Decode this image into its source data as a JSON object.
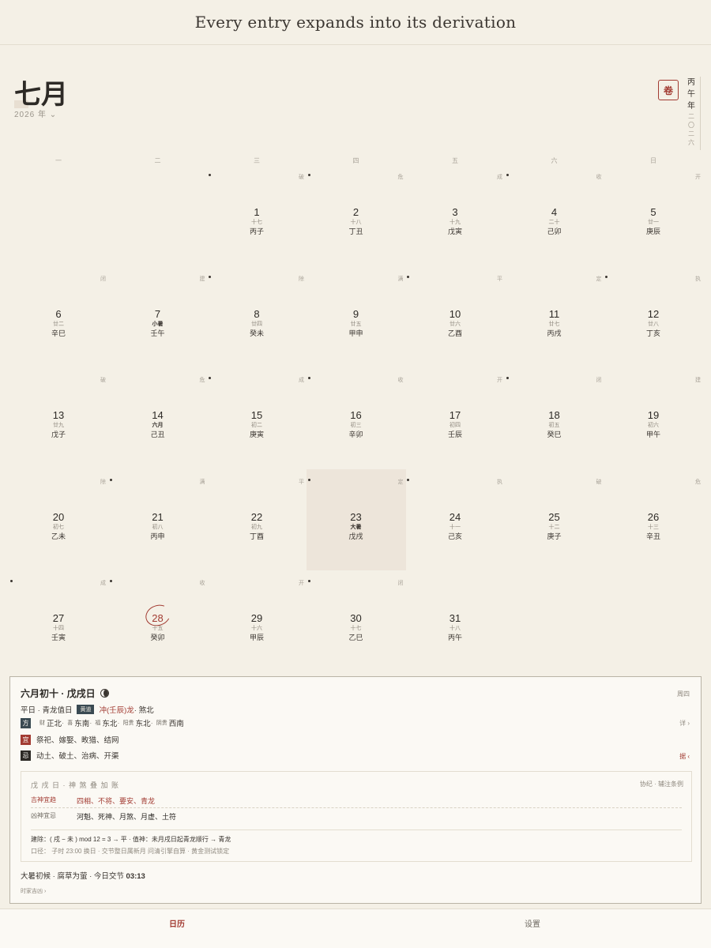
{
  "caption": "Every entry expands into its derivation",
  "header": {
    "month": "七月",
    "year_selector": "2026 年 ⌄",
    "scroll_button": "卷",
    "vertical_year": [
      "丙",
      "午",
      "年"
    ],
    "vertical_year_sub": [
      "二",
      "〇",
      "二",
      "六"
    ]
  },
  "weekdays": [
    "一",
    "二",
    "三",
    "四",
    "五",
    "六",
    "日"
  ],
  "days": [
    {
      "d": "1",
      "lunar": "十七",
      "gz": "丙子",
      "officer": "破",
      "col": 2,
      "row": 0,
      "dot": true
    },
    {
      "d": "2",
      "lunar": "十八",
      "gz": "丁丑",
      "officer": "危",
      "col": 3,
      "row": 0,
      "dot": true
    },
    {
      "d": "3",
      "lunar": "十九",
      "gz": "戊寅",
      "officer": "成",
      "col": 4,
      "row": 0,
      "dot": false
    },
    {
      "d": "4",
      "lunar": "二十",
      "gz": "己卯",
      "officer": "收",
      "col": 5,
      "row": 0,
      "dot": true
    },
    {
      "d": "5",
      "lunar": "廿一",
      "gz": "庚辰",
      "officer": "开",
      "col": 6,
      "row": 0,
      "dot": false
    },
    {
      "d": "6",
      "lunar": "廿二",
      "gz": "辛巳",
      "officer": "闭",
      "col": 0,
      "row": 1,
      "dot": false
    },
    {
      "d": "7",
      "lunar": "小暑",
      "gz": "壬午",
      "officer": "建",
      "col": 1,
      "row": 1,
      "dot": false,
      "term": true
    },
    {
      "d": "8",
      "lunar": "廿四",
      "gz": "癸未",
      "officer": "除",
      "col": 2,
      "row": 1,
      "dot": true
    },
    {
      "d": "9",
      "lunar": "廿五",
      "gz": "甲申",
      "officer": "满",
      "col": 3,
      "row": 1,
      "dot": false
    },
    {
      "d": "10",
      "lunar": "廿六",
      "gz": "乙酉",
      "officer": "平",
      "col": 4,
      "row": 1,
      "dot": true
    },
    {
      "d": "11",
      "lunar": "廿七",
      "gz": "丙戌",
      "officer": "定",
      "col": 5,
      "row": 1,
      "dot": false
    },
    {
      "d": "12",
      "lunar": "廿八",
      "gz": "丁亥",
      "officer": "执",
      "col": 6,
      "row": 1,
      "dot": true
    },
    {
      "d": "13",
      "lunar": "廿九",
      "gz": "戊子",
      "officer": "破",
      "col": 0,
      "row": 2,
      "dot": false
    },
    {
      "d": "14",
      "lunar": "六月",
      "gz": "己丑",
      "officer": "危",
      "col": 1,
      "row": 2,
      "dot": false,
      "term": true
    },
    {
      "d": "15",
      "lunar": "初二",
      "gz": "庚寅",
      "officer": "成",
      "col": 2,
      "row": 2,
      "dot": true
    },
    {
      "d": "16",
      "lunar": "初三",
      "gz": "辛卯",
      "officer": "收",
      "col": 3,
      "row": 2,
      "dot": true
    },
    {
      "d": "17",
      "lunar": "初四",
      "gz": "壬辰",
      "officer": "开",
      "col": 4,
      "row": 2,
      "dot": false
    },
    {
      "d": "18",
      "lunar": "初五",
      "gz": "癸巳",
      "officer": "闭",
      "col": 5,
      "row": 2,
      "dot": true
    },
    {
      "d": "19",
      "lunar": "初六",
      "gz": "甲午",
      "officer": "建",
      "col": 6,
      "row": 2,
      "dot": false
    },
    {
      "d": "20",
      "lunar": "初七",
      "gz": "乙未",
      "officer": "除",
      "col": 0,
      "row": 3,
      "dot": false
    },
    {
      "d": "21",
      "lunar": "初八",
      "gz": "丙申",
      "officer": "满",
      "col": 1,
      "row": 3,
      "dot": true
    },
    {
      "d": "22",
      "lunar": "初九",
      "gz": "丁酉",
      "officer": "平",
      "col": 2,
      "row": 3,
      "dot": false
    },
    {
      "d": "23",
      "lunar": "大暑",
      "gz": "戊戌",
      "officer": "定",
      "col": 3,
      "row": 3,
      "dot": true,
      "term": true,
      "today": true
    },
    {
      "d": "24",
      "lunar": "十一",
      "gz": "己亥",
      "officer": "执",
      "col": 4,
      "row": 3,
      "dot": true
    },
    {
      "d": "25",
      "lunar": "十二",
      "gz": "庚子",
      "officer": "破",
      "col": 5,
      "row": 3,
      "dot": false
    },
    {
      "d": "26",
      "lunar": "十三",
      "gz": "辛丑",
      "officer": "危",
      "col": 6,
      "row": 3,
      "dot": false
    },
    {
      "d": "27",
      "lunar": "十四",
      "gz": "壬寅",
      "officer": "成",
      "col": 0,
      "row": 4,
      "dot": true
    },
    {
      "d": "28",
      "lunar": "十五",
      "gz": "癸卯",
      "officer": "收",
      "col": 1,
      "row": 4,
      "dot": true,
      "circled": true
    },
    {
      "d": "29",
      "lunar": "十六",
      "gz": "甲辰",
      "officer": "开",
      "col": 2,
      "row": 4,
      "dot": false
    },
    {
      "d": "30",
      "lunar": "十七",
      "gz": "乙巳",
      "officer": "闭",
      "col": 3,
      "row": 4,
      "dot": true
    },
    {
      "d": "31",
      "lunar": "十八",
      "gz": "丙午",
      "officer": "",
      "col": 4,
      "row": 4,
      "dot": false
    }
  ],
  "panel": {
    "title": "六月初十 · 戊戌日",
    "weekday": "周四",
    "row1_a": "平日 · 青龙值日",
    "row1_tag": "黄道",
    "row1_red": "冲(壬辰)龙",
    "row1_b": " · 煞北",
    "dir_label": "方",
    "dir": [
      {
        "k": "财",
        "v": "正北"
      },
      {
        "k": "喜",
        "v": "东南"
      },
      {
        "k": "福",
        "v": "东北"
      },
      {
        "k": "阳贵",
        "v": "东北"
      },
      {
        "k": "阴贵",
        "v": "西南"
      }
    ],
    "detail_link": "详 ›",
    "yi_label": "宜",
    "yi": "祭祀、嫁娶、畋猎、结网",
    "ji_label": "忌",
    "ji": "动土、破土、治病、开渠",
    "basis_link": "据 ‹",
    "sub": {
      "head": "戊 戌 日  ·  神 煞 叠 加 账",
      "ref": "协纪 · 辅注条例",
      "good_label": "吉神宜趋",
      "good": "四相、不将、要安、青龙",
      "bad_label": "凶神宜忌",
      "bad": "河魁、死神、月煞、月虚、土符",
      "formula": "建除：( 戌 − 未 ) mod 12 = 3 → 平    ·    值神：未月戌日起青龙顺行 → 青龙",
      "formula2": "口径：  子时 23:00 换日 · 交节整日属新月      问清引擎自算 · 黄金测试锁定"
    },
    "season": "大暑初候 · 腐草为萤 · 今日交节",
    "season_time": "03:13",
    "more": "时家吉凶 ›"
  },
  "tabs": {
    "calendar": "日历",
    "settings": "设置"
  }
}
